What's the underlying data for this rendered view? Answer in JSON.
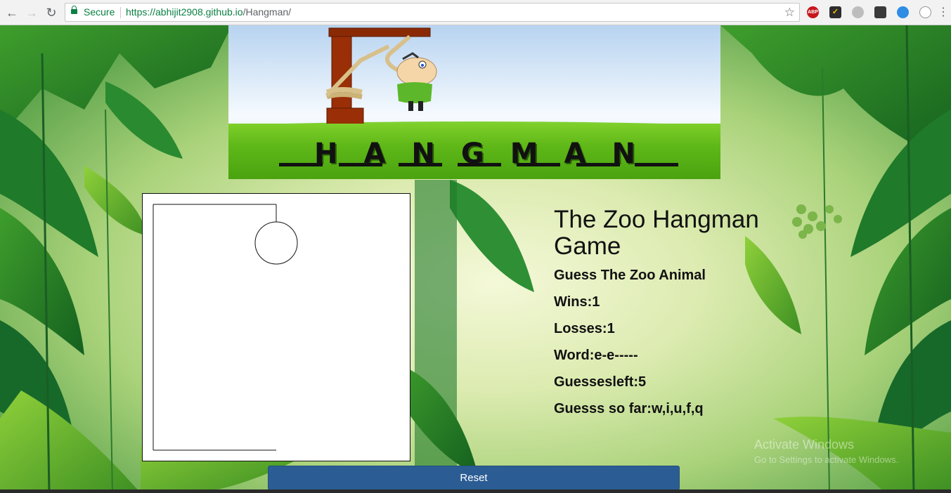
{
  "browser": {
    "secure_label": "Secure",
    "url_origin": "https://abhijit2908.github.io",
    "url_path": "/Hangman/",
    "extensions": [
      "ABP",
      "checkmark-shield",
      "ghost",
      "privacy-badge",
      "chrome-compass",
      "smiley"
    ]
  },
  "hero": {
    "title": "HANGMAN"
  },
  "game": {
    "title": "The Zoo Hangman Game",
    "subtitle": "Guess The Zoo Animal",
    "wins": "Wins:1",
    "losses": "Losses:1",
    "word": "Word:e-e-----",
    "guesses_left": "Guessesleft:5",
    "guessed_so_far": "Guesss so far:w,i,u,f,q"
  },
  "reset_label": "Reset",
  "watermark": {
    "line1": "Activate Windows",
    "line2": "Go to Settings to activate Windows."
  },
  "colors": {
    "button": "#2b5d94",
    "secure_green": "#0b8043",
    "grass": "#5fb818"
  }
}
